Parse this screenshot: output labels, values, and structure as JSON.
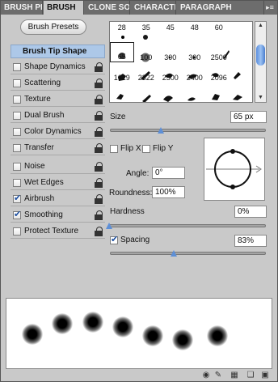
{
  "tabs": [
    {
      "label": "BRUSH PRE",
      "active": false
    },
    {
      "label": "BRUSH",
      "active": true
    },
    {
      "label": "CLONE SOU",
      "active": false
    },
    {
      "label": "CHARACTE",
      "active": false
    },
    {
      "label": "PARAGRAPH",
      "active": false
    }
  ],
  "left": {
    "presets_button": "Brush Presets",
    "tip_shape": "Brush Tip Shape",
    "options": [
      {
        "label": "Shape Dynamics",
        "checked": false
      },
      {
        "label": "Scattering",
        "checked": false
      },
      {
        "label": "Texture",
        "checked": false
      },
      {
        "label": "Dual Brush",
        "checked": false
      },
      {
        "label": "Color Dynamics",
        "checked": false
      },
      {
        "label": "Transfer",
        "checked": false
      },
      {
        "label": "Noise",
        "checked": false
      },
      {
        "label": "Wet Edges",
        "checked": false
      },
      {
        "label": "Airbrush",
        "checked": true
      },
      {
        "label": "Smoothing",
        "checked": true
      },
      {
        "label": "Protect Texture",
        "checked": false
      }
    ]
  },
  "brush_grid": {
    "cells": [
      "28",
      "35",
      "45",
      "48",
      "60",
      "65",
      "100",
      "300",
      "300",
      "2500",
      "1619",
      "2322",
      "2500",
      "2400",
      "2096",
      "",
      "",
      "",
      "",
      ""
    ],
    "selected": "65"
  },
  "size": {
    "label": "Size",
    "value": "65 px",
    "level": 0.37
  },
  "flip": {
    "x_label": "Flip X",
    "y_label": "Flip Y"
  },
  "angle": {
    "label": "Angle:",
    "value": "0°"
  },
  "roundness": {
    "label": "Roundness:",
    "value": "100%"
  },
  "hardness": {
    "label": "Hardness",
    "value": "0%",
    "level": 0.0
  },
  "spacing": {
    "label": "Spacing",
    "value": "83%",
    "checked": true,
    "level": 0.4
  },
  "colors": {
    "accent": "#5d8fd6",
    "selection": "#adc8e8",
    "panel": "#c9c9c9"
  }
}
